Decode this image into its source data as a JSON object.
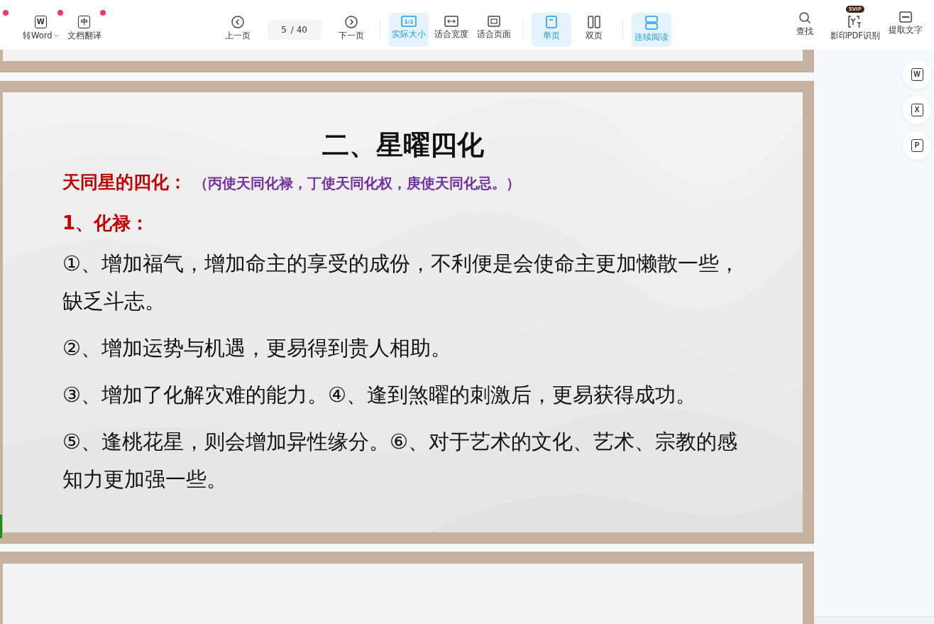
{
  "toolbar": {
    "left": [
      {
        "label": "转Word",
        "icon_letter": "W",
        "dropdown": true,
        "badge": true
      },
      {
        "label": "文档翻译",
        "icon_letter": "中",
        "dropdown": false,
        "badge": true
      }
    ],
    "prev": "上一页",
    "page": {
      "current": "5",
      "total": "/ 40"
    },
    "next": "下一页",
    "groups": [
      [
        {
          "label": "实际大小",
          "icon_letter": "1:1",
          "selected": true
        },
        {
          "label": "适合宽度",
          "selected": false
        },
        {
          "label": "适合页面",
          "selected": false
        }
      ],
      [
        {
          "label": "单页",
          "selected": true
        },
        {
          "label": "双页",
          "selected": false
        }
      ],
      [
        {
          "label": "连续阅读",
          "selected": true
        }
      ]
    ],
    "right": [
      {
        "label": "查找"
      },
      {
        "label": "影印PDF识别",
        "badge": "SVIP"
      },
      {
        "label": "提取文字"
      }
    ]
  },
  "document": {
    "title": "二、星曜四化",
    "heading": "天同星的四化：",
    "note": "（丙使天同化禄，丁使天同化权，庚使天同化忌。）",
    "subheading": "1、化禄：",
    "paragraphs": [
      "①、增加福气，增加命主的享受的成份，不利便是会使命主更加懒散一些，缺乏斗志。",
      "②、增加运势与机遇，更易得到贵人相助。",
      "③、增加了化解灾难的能力。④、逢到煞曜的刺激后，更易获得成功。",
      "⑤、逢桃花星，则会增加异性缘分。⑥、对于艺术的文化、艺术、宗教的感知力更加强一些。"
    ]
  },
  "side_buttons": [
    {
      "letter": "W"
    },
    {
      "letter": "X"
    },
    {
      "letter": "P"
    }
  ]
}
